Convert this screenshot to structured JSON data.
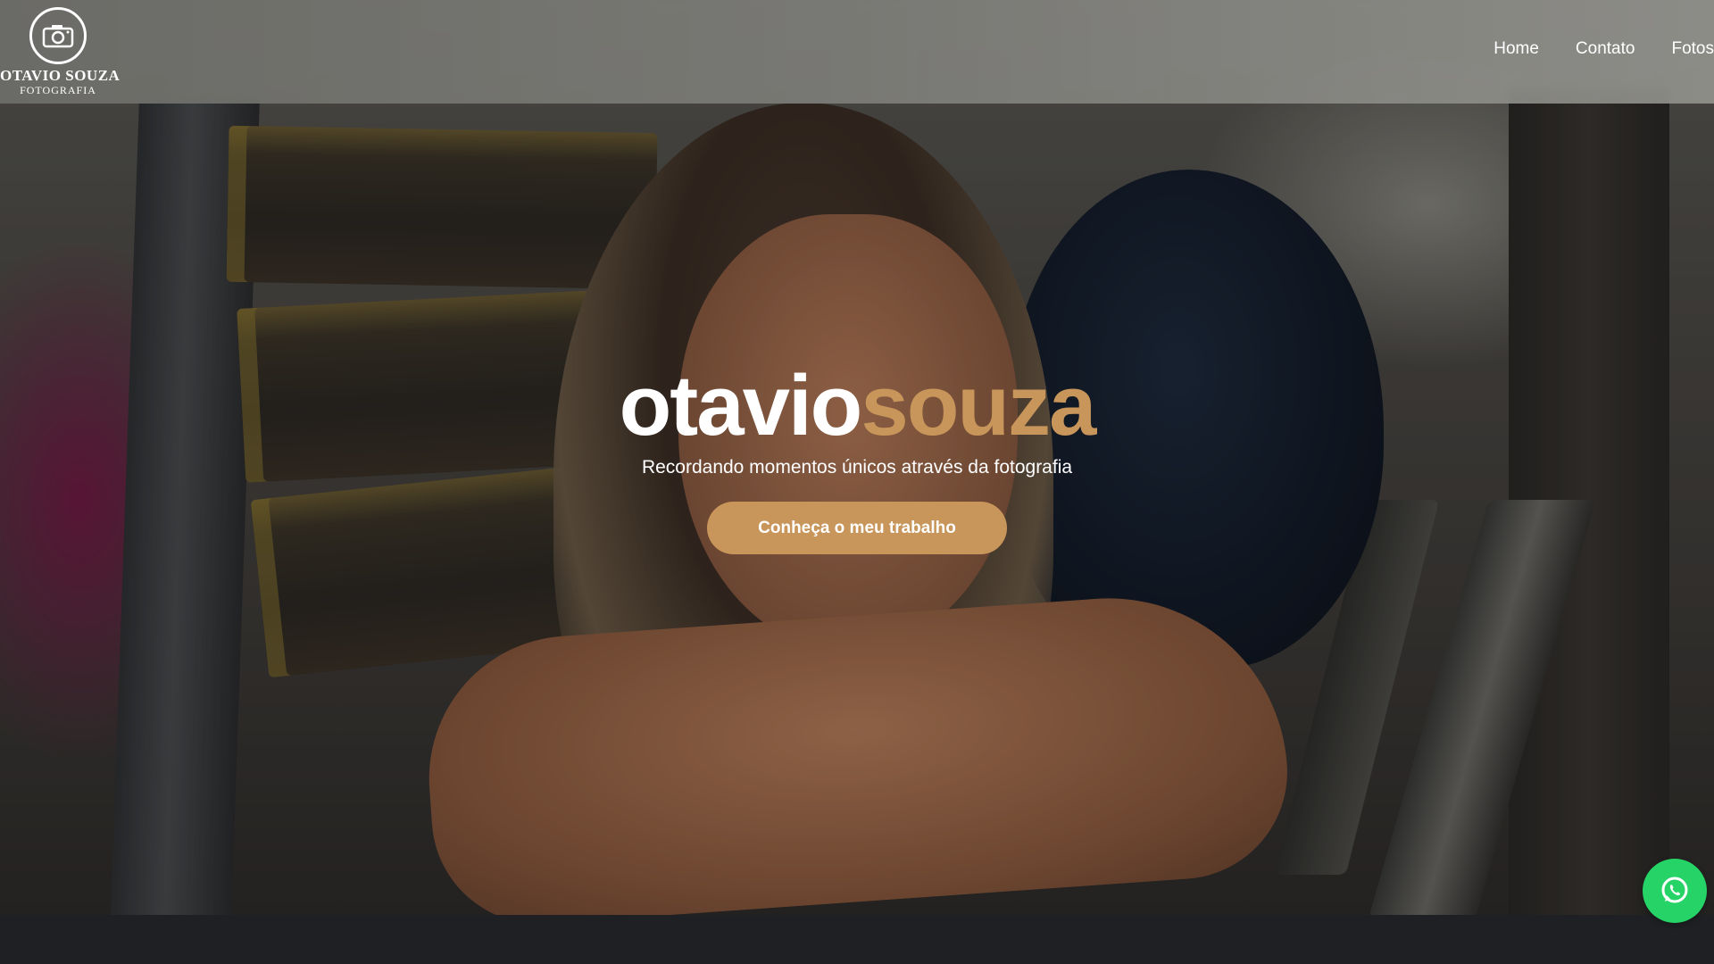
{
  "logo": {
    "name": "OTAVIO SOUZA",
    "subtitle": "FOTOGRAFIA",
    "icon": "camera-icon"
  },
  "nav": {
    "items": [
      {
        "label": "Home"
      },
      {
        "label": "Contato"
      },
      {
        "label": "Fotos"
      }
    ]
  },
  "hero": {
    "brand_first": "otavio",
    "brand_second": "souza",
    "tagline": "Recordando momentos únicos através da fotografia",
    "cta_label": "Conheça o meu trabalho"
  },
  "whatsapp": {
    "icon": "whatsapp-icon"
  },
  "colors": {
    "accent": "#c8955a",
    "whatsapp": "#25d366",
    "footer": "#1f2023"
  }
}
